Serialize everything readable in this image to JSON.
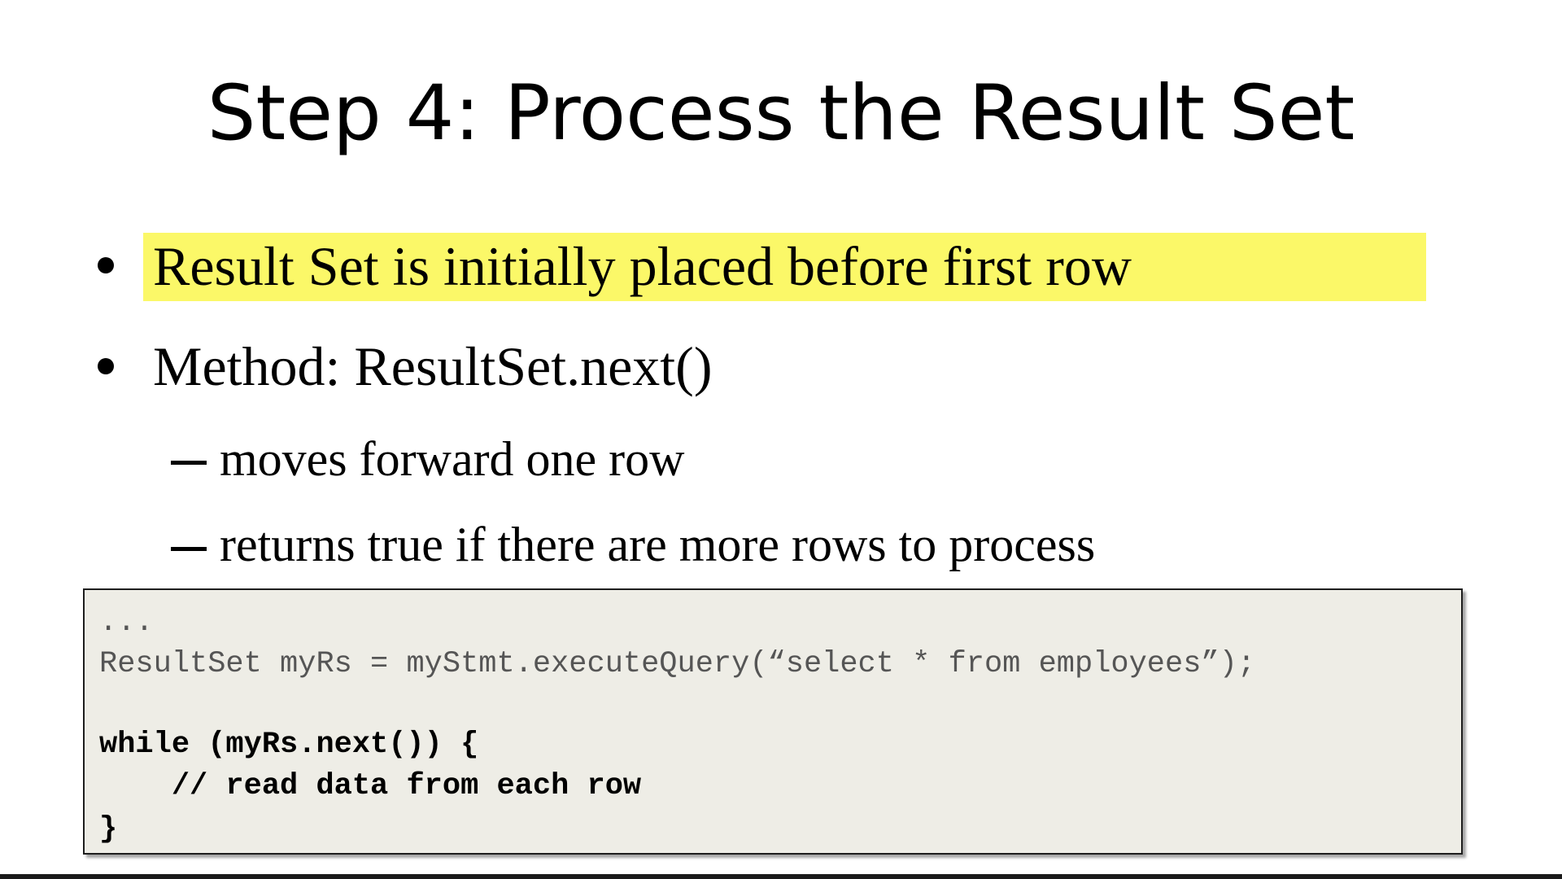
{
  "slide": {
    "title": "Step 4: Process the Result Set",
    "bullets": [
      {
        "text": "Result Set is initially placed before first row",
        "highlighted": true,
        "highlight_color": "#fbf868"
      },
      {
        "text": "Method: ResultSet.next()",
        "highlighted": false
      }
    ],
    "sub_bullets": [
      "moves forward one row",
      "returns true if there are more rows to process"
    ],
    "code": {
      "lines": [
        "...",
        "ResultSet myRs = myStmt.executeQuery(“select * from employees”);",
        "",
        "while (myRs.next()) {",
        "    // read data from each row",
        "}"
      ],
      "background": "#eeede6"
    }
  }
}
